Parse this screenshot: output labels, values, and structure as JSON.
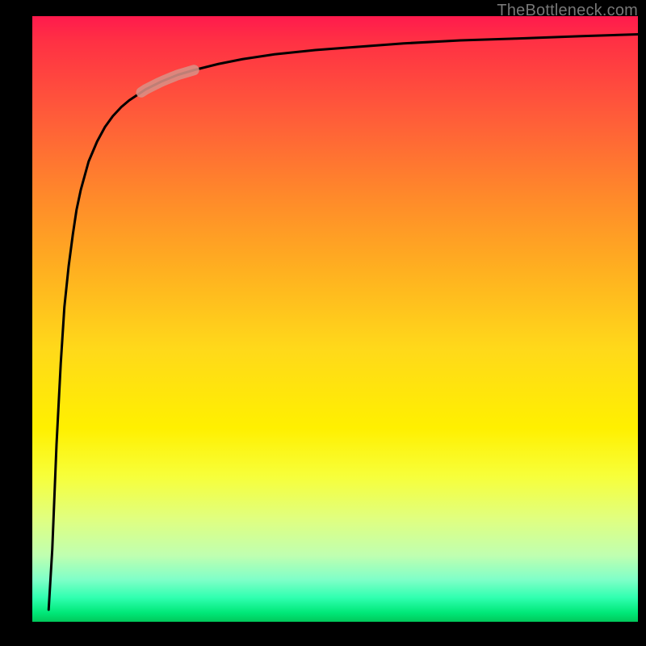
{
  "attribution": "TheBottleneck.com",
  "colors": {
    "page_bg": "#000000",
    "curve": "#000000",
    "highlight": "#d98f85",
    "gradient_top": "#ff1a4d",
    "gradient_bottom": "#00c85a"
  },
  "chart_data": {
    "type": "line",
    "title": "",
    "xlabel": "",
    "ylabel": "",
    "xlim": [
      0,
      100
    ],
    "ylim": [
      0,
      100
    ],
    "grid": false,
    "legend": false,
    "series": [
      {
        "name": "curve",
        "x": [
          2.7,
          3.3,
          4.0,
          4.7,
          5.3,
          6.0,
          6.7,
          7.3,
          8.0,
          9.3,
          10.7,
          12.0,
          13.3,
          14.7,
          16.0,
          18.7,
          21.3,
          24.0,
          26.7,
          30.7,
          34.7,
          40.0,
          46.7,
          53.3,
          61.3,
          70.7,
          80.0,
          90.7,
          100.0
        ],
        "y": [
          2.0,
          12.0,
          29.3,
          42.7,
          52.0,
          58.7,
          64.0,
          68.0,
          71.3,
          76.0,
          79.3,
          81.7,
          83.5,
          85.0,
          86.1,
          87.9,
          89.2,
          90.3,
          91.1,
          92.1,
          92.9,
          93.7,
          94.4,
          94.9,
          95.5,
          96.0,
          96.3,
          96.7,
          97.0
        ]
      }
    ],
    "highlight_segment": {
      "series": "curve",
      "x_start": 18.0,
      "x_end": 26.7,
      "y_start": 87.5,
      "y_end": 91.1
    }
  }
}
